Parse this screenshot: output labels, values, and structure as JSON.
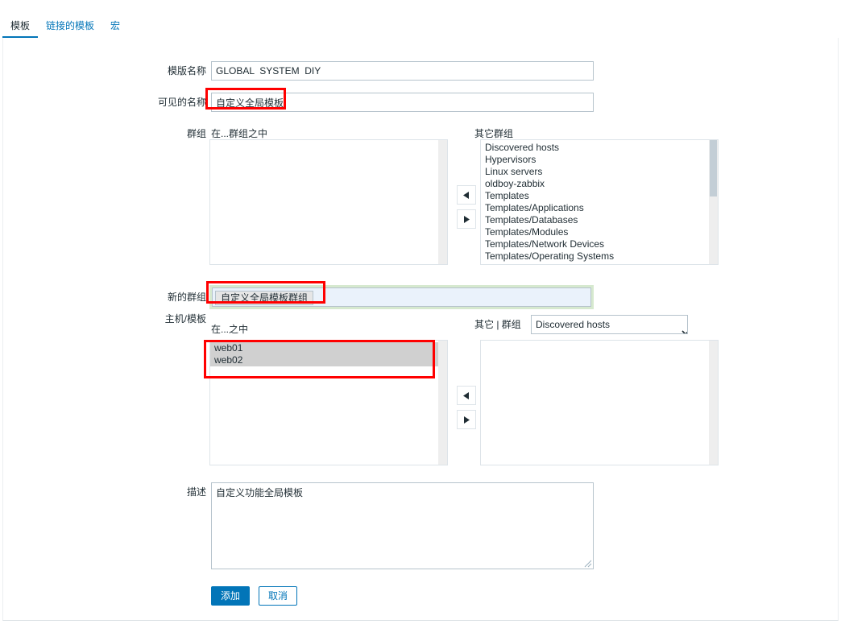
{
  "tabs": [
    {
      "label": "模板",
      "active": true
    },
    {
      "label": "链接的模板",
      "active": false
    },
    {
      "label": "宏",
      "active": false
    }
  ],
  "form": {
    "template_name": {
      "label": "模版名称",
      "value": "GLOBAL  SYSTEM  DIY",
      "placeholder": ""
    },
    "visible_name": {
      "label": "可见的名称",
      "value": "自定义全局模板",
      "placeholder": ""
    },
    "groups": {
      "label": "群组",
      "left_caption": "在...群组之中",
      "right_caption": "其它群组",
      "left_options": [],
      "right_options": [
        "Discovered hosts",
        "Hypervisors",
        "Linux servers",
        "oldboy-zabbix",
        "Templates",
        "Templates/Applications",
        "Templates/Databases",
        "Templates/Modules",
        "Templates/Network Devices",
        "Templates/Operating Systems"
      ],
      "move_left_icon": "triangle-left-icon",
      "move_right_icon": "triangle-right-icon"
    },
    "new_group": {
      "label": "新的群组",
      "value": "自定义全局模板群组",
      "placeholder": ""
    },
    "hosts_templates": {
      "label": "主机/模板",
      "left_caption": "在...之中",
      "right_caption": "其它 | 群组",
      "left_options": [
        "web01",
        "web02"
      ],
      "left_selected": [
        "web01",
        "web02"
      ],
      "right_options": [],
      "group_filter_value": "Discovered hosts",
      "group_filter_caret_icon": "chevron-down-icon",
      "move_left_icon": "triangle-left-icon",
      "move_right_icon": "triangle-right-icon"
    },
    "description": {
      "label": "描述",
      "value": "自定义功能全局模板",
      "placeholder": ""
    },
    "actions": {
      "submit_label": "添加",
      "cancel_label": "取消"
    }
  },
  "colors": {
    "accent": "#0275b8",
    "annotation": "#ff0000",
    "selected_row": "#d0d0d0",
    "multiselect_bg": "#eaf2fb",
    "multiselect_outline": "#d6e9cf"
  }
}
